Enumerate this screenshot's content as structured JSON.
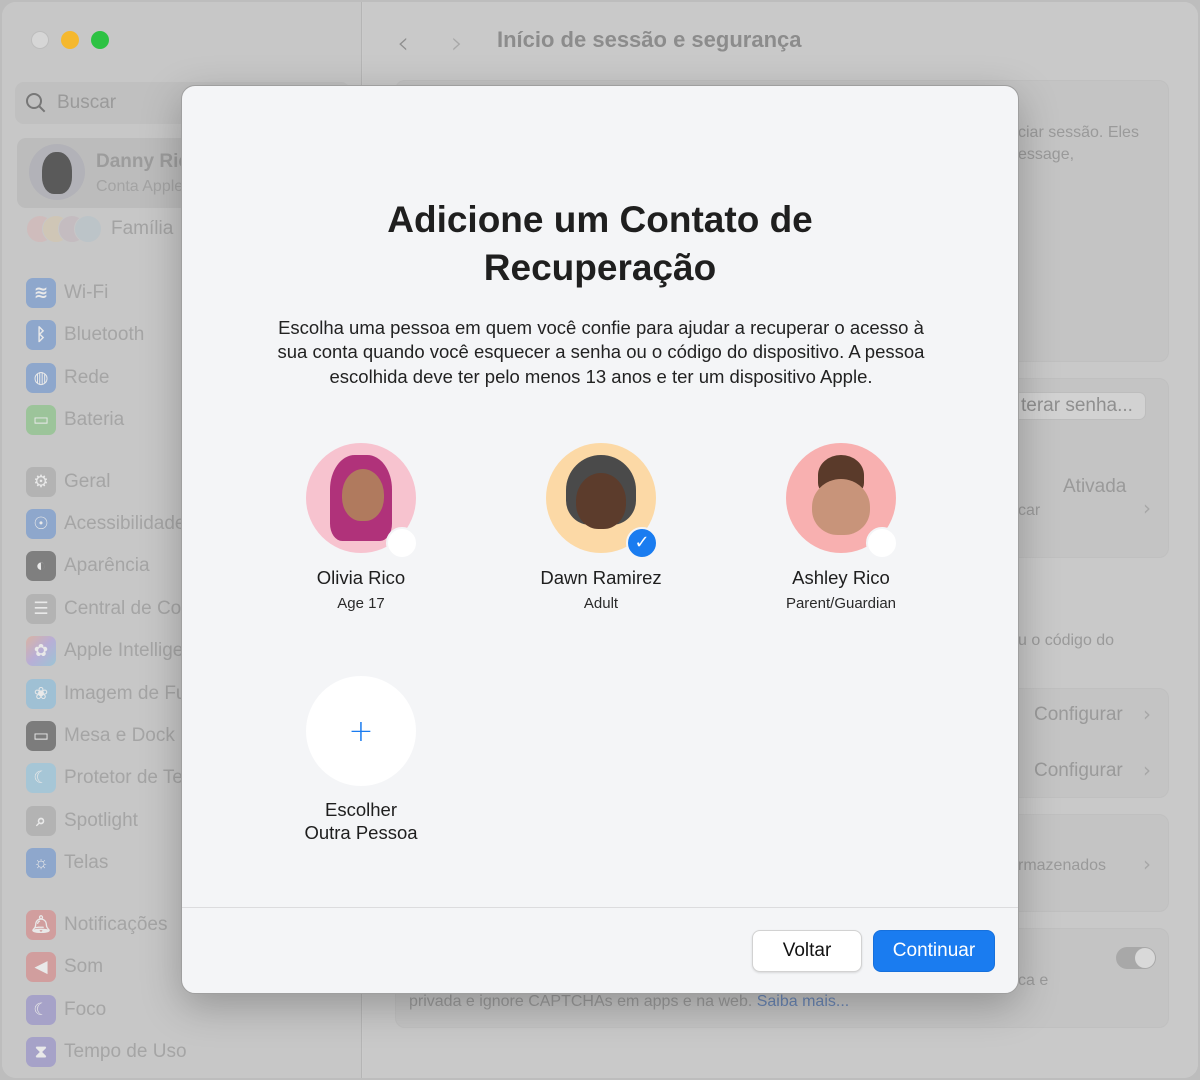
{
  "window": {
    "traffic_lights": [
      "close",
      "minimize",
      "maximize"
    ],
    "colors": {
      "minimize": "#f5b82e",
      "maximize": "#2dc243",
      "accent": "#1a7cf0"
    }
  },
  "sidebar": {
    "search": {
      "placeholder": "Buscar",
      "value": ""
    },
    "account": {
      "name": "Danny Rico",
      "subtitle": "Conta Apple"
    },
    "family_label": "Família",
    "items": [
      {
        "label": "Wi-Fi",
        "icon": "wifi-icon"
      },
      {
        "label": "Bluetooth",
        "icon": "bluetooth-icon"
      },
      {
        "label": "Rede",
        "icon": "globe-icon"
      },
      {
        "label": "Bateria",
        "icon": "battery-icon"
      },
      {
        "label": "Geral",
        "icon": "gear-icon"
      },
      {
        "label": "Acessibilidade",
        "icon": "accessibility-icon"
      },
      {
        "label": "Aparência",
        "icon": "appearance-icon"
      },
      {
        "label": "Central de Controle",
        "icon": "control-center-icon"
      },
      {
        "label": "Apple Intelligence",
        "icon": "apple-intelligence-icon"
      },
      {
        "label": "Imagem de Fundo",
        "icon": "wallpaper-icon"
      },
      {
        "label": "Mesa e Dock",
        "icon": "dock-icon"
      },
      {
        "label": "Protetor de Tela",
        "icon": "screensaver-icon"
      },
      {
        "label": "Spotlight",
        "icon": "search-icon"
      },
      {
        "label": "Telas",
        "icon": "display-icon"
      },
      {
        "label": "Notificações",
        "icon": "notifications-icon"
      },
      {
        "label": "Som",
        "icon": "sound-icon"
      },
      {
        "label": "Foco",
        "icon": "focus-moon-icon"
      },
      {
        "label": "Tempo de Uso",
        "icon": "hourglass-icon"
      }
    ]
  },
  "main": {
    "title": "Início de sessão e segurança",
    "background_fragments": {
      "text1_line1": "ciar sessão. Eles",
      "text1_line2": "essage,",
      "change_password": "terar senha...",
      "status_on": "Ativada",
      "row_fragment": "car",
      "recovery_text": "u o código do",
      "configure1": "Configurar",
      "configure2": "Configurar",
      "stored": "rmazenados",
      "toggle_text": "ca e",
      "captcha_text": "privada e ignore CAPTCHAs em apps e na web.",
      "learn_more": "Saiba mais..."
    }
  },
  "dialog": {
    "title": "Adicione um Contato de Recuperação",
    "description": "Escolha uma pessoa em quem você confie para ajudar a recuperar o acesso à sua conta quando você esquecer a senha ou o código do dispositivo. A pessoa escolhida deve ter pelo menos 13 anos e ter um dispositivo Apple.",
    "contacts": [
      {
        "name": "Olivia Rico",
        "relation": "Age 17",
        "selected": false
      },
      {
        "name": "Dawn Ramirez",
        "relation": "Adult",
        "selected": true
      },
      {
        "name": "Ashley Rico",
        "relation": "Parent/Guardian",
        "selected": false
      }
    ],
    "add_other": {
      "line1": "Escolher",
      "line2": "Outra Pessoa",
      "icon": "+"
    },
    "check_glyph": "✓",
    "buttons": {
      "back": "Voltar",
      "continue": "Continuar"
    }
  }
}
